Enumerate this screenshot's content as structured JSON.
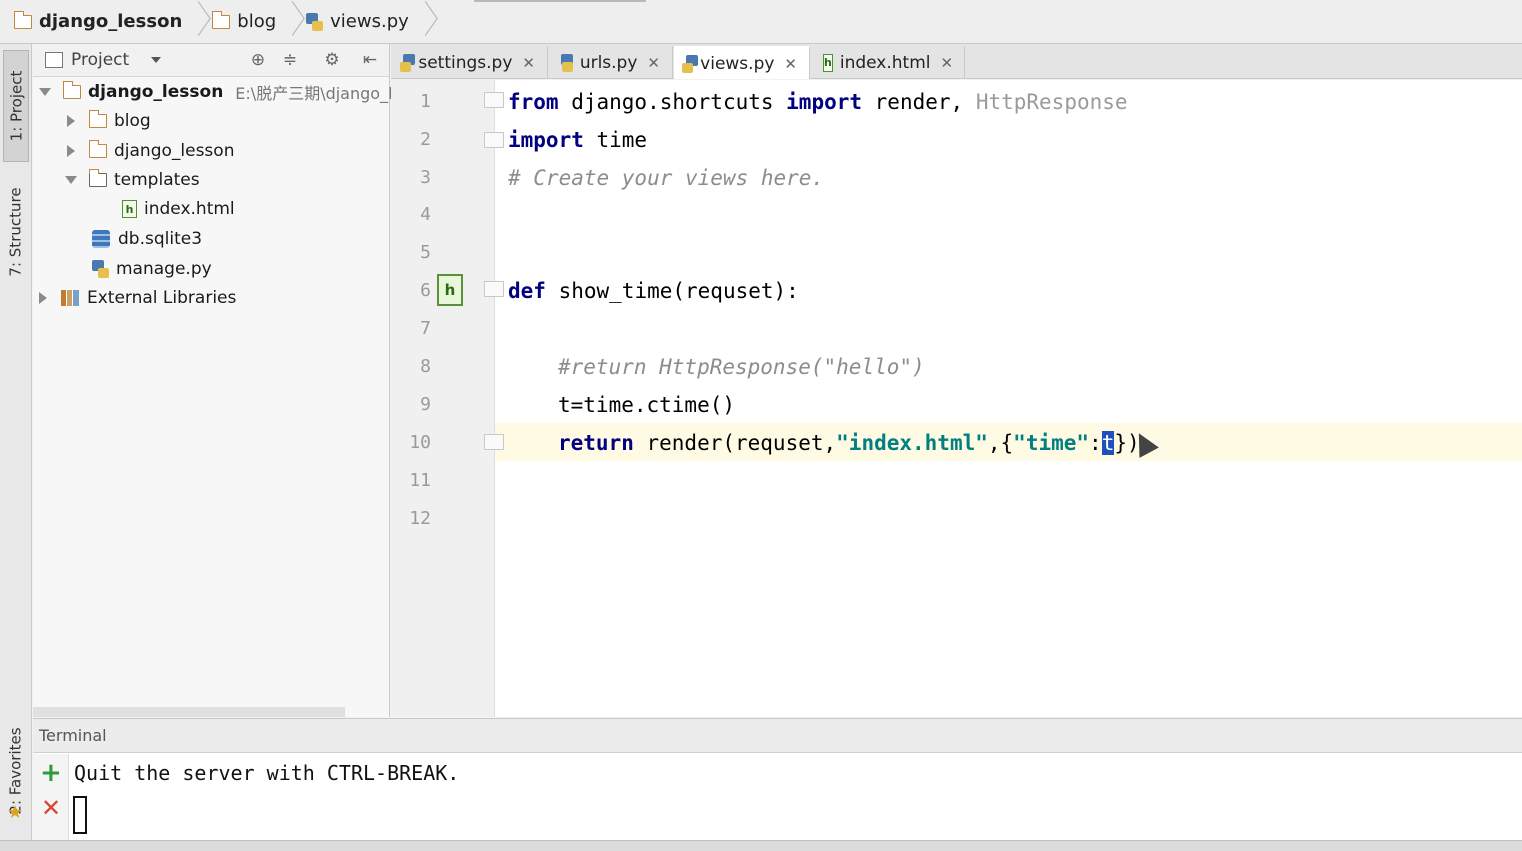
{
  "breadcrumb": {
    "project": "django_lesson",
    "folder": "blog",
    "file": "views.py"
  },
  "left_strip": {
    "project_label": "1: Project",
    "structure_label": "7: Structure",
    "favorites_label": "2: Favorites"
  },
  "project_panel": {
    "title": "Project",
    "tree": {
      "root": "django_lesson",
      "root_path": "E:\\脱产三期\\django_l",
      "blog": "blog",
      "django_lesson": "django_lesson",
      "templates": "templates",
      "index_html": "index.html",
      "db": "db.sqlite3",
      "manage": "manage.py",
      "external": "External Libraries"
    }
  },
  "editor_tabs": [
    {
      "label": "settings.py",
      "icon": "python-file-icon"
    },
    {
      "label": "urls.py",
      "icon": "python-file-icon"
    },
    {
      "label": "views.py",
      "icon": "python-file-icon",
      "active": true
    },
    {
      "label": "index.html",
      "icon": "html-file-icon"
    }
  ],
  "editor": {
    "line_numbers": [
      "1",
      "2",
      "3",
      "4",
      "5",
      "6",
      "7",
      "8",
      "9",
      "10",
      "11",
      "12"
    ],
    "code": {
      "l1_kw1": "from",
      "l1_mod": " django.shortcuts ",
      "l1_kw2": "import",
      "l1_names": " render,",
      "l1_unused": " HttpResponse",
      "l2_kw": "import",
      "l2_rest": " time",
      "l3_comment": "# Create your views here.",
      "l6_kw": "def",
      "l6_rest": " show_time(requset):",
      "l8_comment": "#return HttpResponse(\"hello\")",
      "l9": "t=time.ctime()",
      "l10_kw": "return",
      "l10_a": " render(requset,",
      "l10_str1": "\"index.html\"",
      "l10_b": ",{",
      "l10_str2": "\"time\"",
      "l10_c": ":",
      "l10_sel": "t",
      "l10_d": "})"
    },
    "gutter_icon": "h"
  },
  "terminal": {
    "title": "Terminal",
    "output": "Quit the server with CTRL-BREAK."
  }
}
